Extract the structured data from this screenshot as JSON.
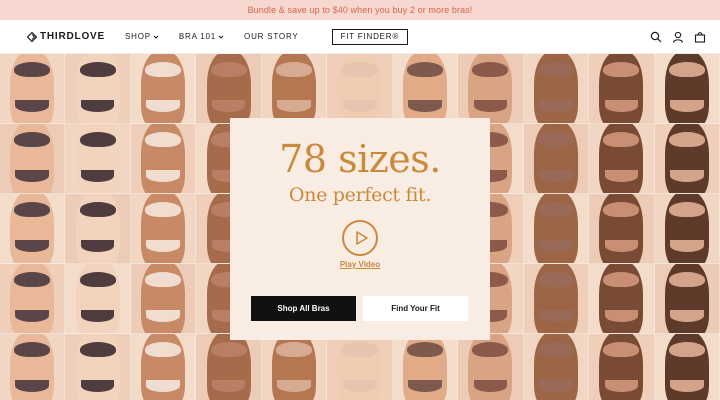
{
  "promo": {
    "text": "Bundle & save up to $40 when you buy 2 or more bras!"
  },
  "nav": {
    "logo": "THIRDLOVE",
    "links": [
      {
        "label": "SHOP",
        "has_dropdown": true
      },
      {
        "label": "BRA 101",
        "has_dropdown": true
      },
      {
        "label": "OUR STORY",
        "has_dropdown": false
      }
    ],
    "fit_finder": "FIT FINDER®",
    "icons": [
      "search-icon",
      "account-icon",
      "cart-icon"
    ]
  },
  "hero": {
    "headline": "78 sizes.",
    "subline": "One perfect fit.",
    "play_label": "Play Video",
    "primary_cta": "Shop All Bras",
    "secondary_cta": "Find Your Fit"
  },
  "colors": {
    "promo_bg": "#f6d8d0",
    "promo_text": "#d4664e",
    "accent": "#c98a3c",
    "card_bg": "#f8ece3",
    "dark_button": "#111111"
  }
}
